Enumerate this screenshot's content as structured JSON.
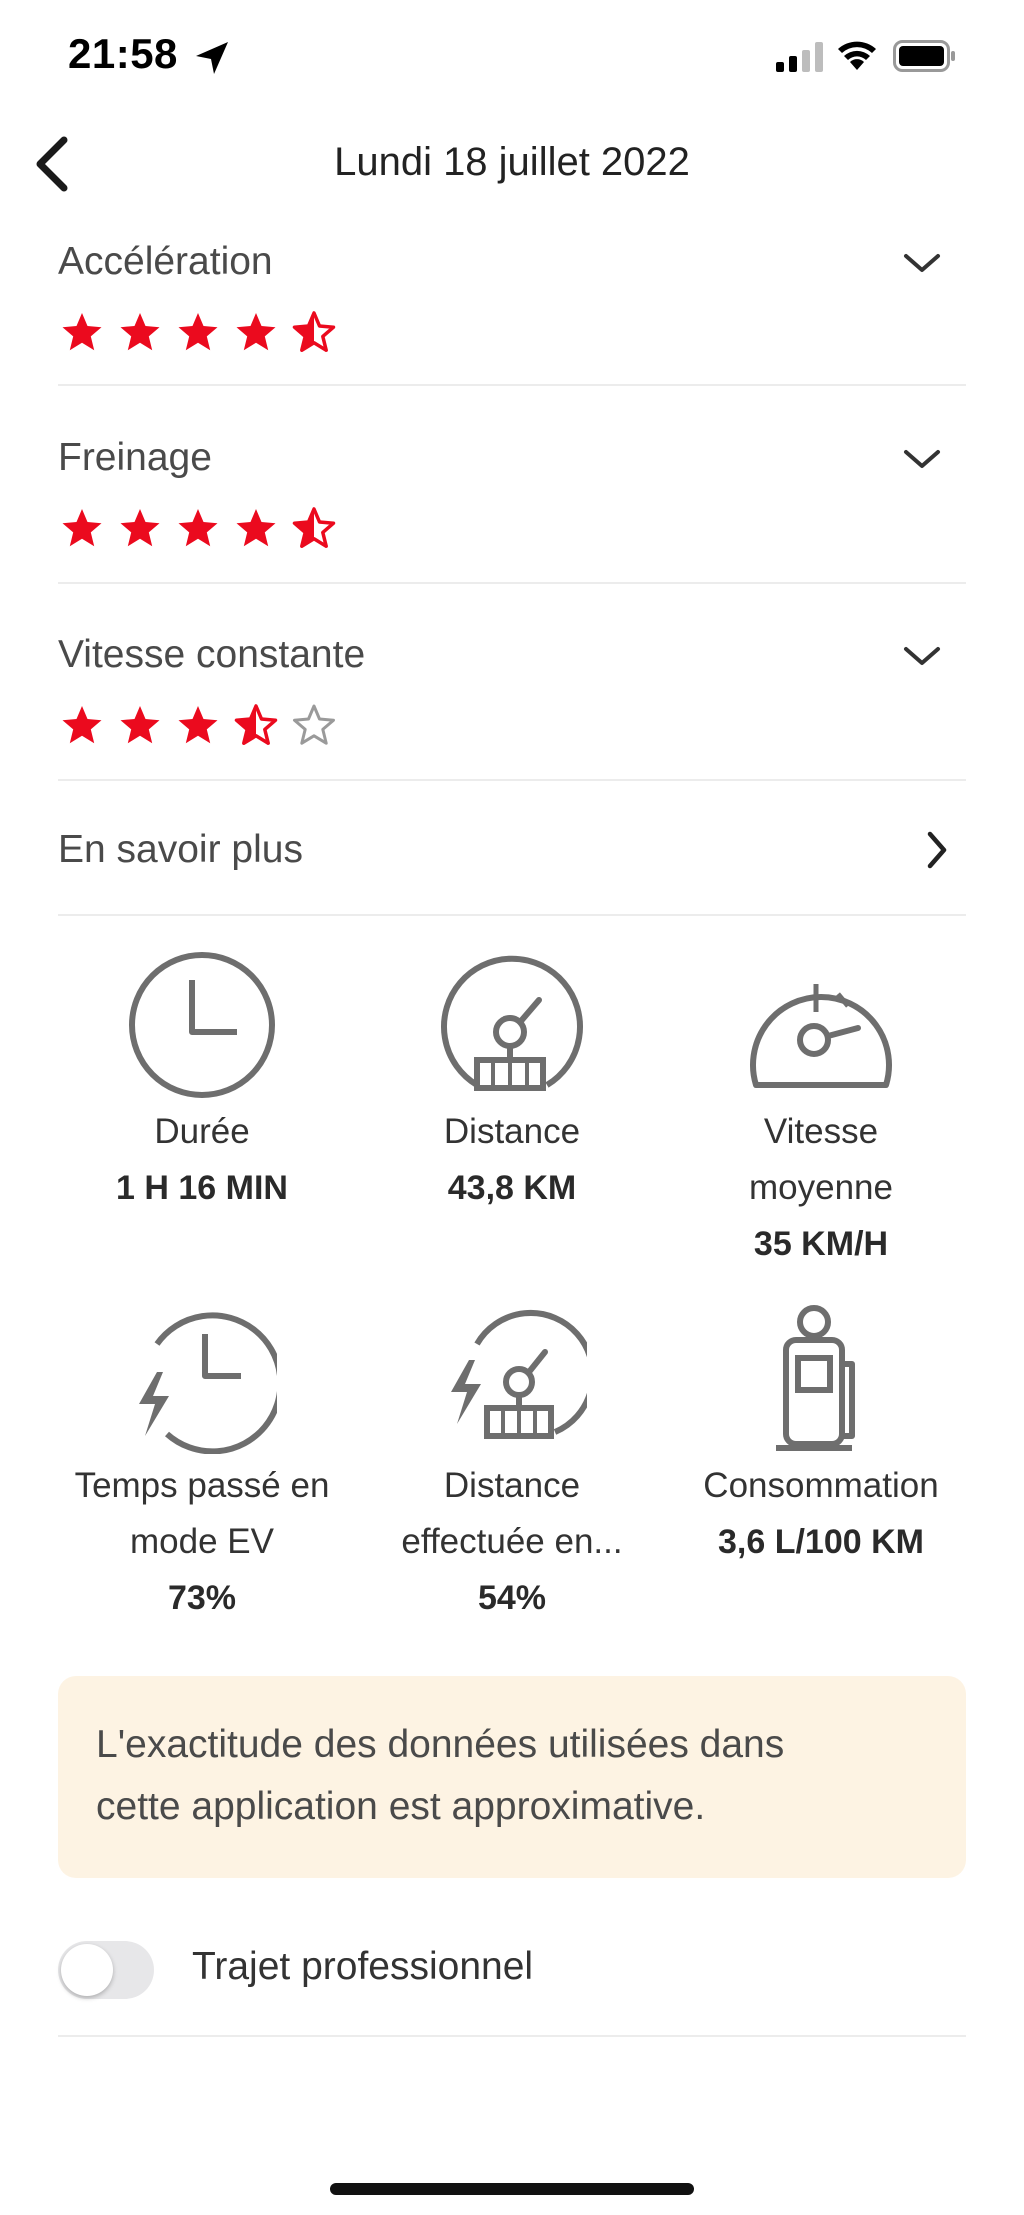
{
  "status_bar": {
    "time": "21:58",
    "location_icon": "location-arrow-icon",
    "signal_icon": "cellular-signal-icon",
    "wifi_icon": "wifi-icon",
    "battery_icon": "battery-icon"
  },
  "nav": {
    "back_icon": "chevron-left-icon",
    "title": "Lundi 18 juillet 2022"
  },
  "ratings": [
    {
      "label": "Accélération",
      "stars": 4.5
    },
    {
      "label": "Freinage",
      "stars": 4.5
    },
    {
      "label": "Vitesse constante",
      "stars": 3.5
    }
  ],
  "rating_max": 5,
  "more": {
    "label": "En savoir plus"
  },
  "stats": [
    {
      "icon": "clock-icon",
      "name": "Durée",
      "value": "1 H 16 MIN"
    },
    {
      "icon": "speedometer-distance-icon",
      "name": "Distance",
      "value": "43,8 KM"
    },
    {
      "icon": "speedometer-icon",
      "name_line1": "Vitesse",
      "name_line2": "moyenne",
      "value": "35 KM/H"
    },
    {
      "icon": "ev-clock-icon",
      "name_line1": "Temps passé en",
      "name_line2": "mode EV",
      "value": "73%"
    },
    {
      "icon": "ev-distance-icon",
      "name_line1": "Distance",
      "name_line2": "effectuée en...",
      "value": "54%"
    },
    {
      "icon": "fuel-pump-icon",
      "name": "Consommation",
      "value": "3,6 L/100 KM"
    }
  ],
  "notice": {
    "line1": "L'exactitude des données utilisées dans",
    "line2": "cette application est approximative."
  },
  "business_trip": {
    "label": "Trajet professionnel",
    "enabled": false
  },
  "colors": {
    "star": "#eb0a1e",
    "star_empty": "#9a9a9a",
    "icon_gray": "#6e6e6e",
    "notice_bg": "#fdf3e3",
    "toggle_off": "#e7e7e9"
  }
}
